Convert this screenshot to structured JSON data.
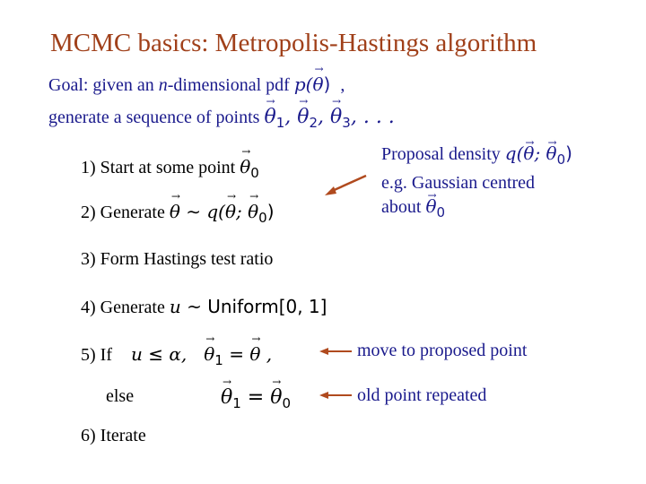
{
  "title": "MCMC basics:  Metropolis-Hastings algorithm",
  "goal": {
    "line1_prefix": "Goal:  given an ",
    "line1_n": "n",
    "line1_suffix": "-dimensional pdf ",
    "pdf_expr_p": "p(",
    "pdf_expr_theta": "θ",
    "pdf_expr_close": ")",
    "pdf_comma": ",",
    "line2": "generate a sequence of points ",
    "seq_theta": "θ",
    "seq_subs": [
      "1",
      "2",
      "3"
    ],
    "seq_ellipsis": ", . . ."
  },
  "steps": [
    {
      "label": "1)  Start at some point ",
      "math_theta": "θ",
      "math_sub": "0"
    },
    {
      "label": "2)  Generate ",
      "math": "θ ~ q(θ; θ0)"
    },
    {
      "label": "3)  Form Hastings test ratio"
    },
    {
      "label": "4)  Generate ",
      "math_u": "u",
      "math_rest": " ~ Uniform[0, 1]"
    },
    {
      "label": "5)  If ",
      "math_cond": "u ≤ α,",
      "math_assign": "θ1 = θ ,"
    },
    {
      "label": "else",
      "math_assign": "θ1 = θ0"
    },
    {
      "label": "6)  Iterate"
    }
  ],
  "annotations": {
    "proposal_line1": "Proposal density ",
    "proposal_math": "q(θ; θ0)",
    "proposal_line2": "e.g. Gaussian centred",
    "proposal_line3": "about ",
    "move": "move to proposed point",
    "old": "old point repeated"
  },
  "colors": {
    "title": "#a0401a",
    "annotation_text": "#1a1a8c",
    "arrow": "#b04a1e"
  }
}
